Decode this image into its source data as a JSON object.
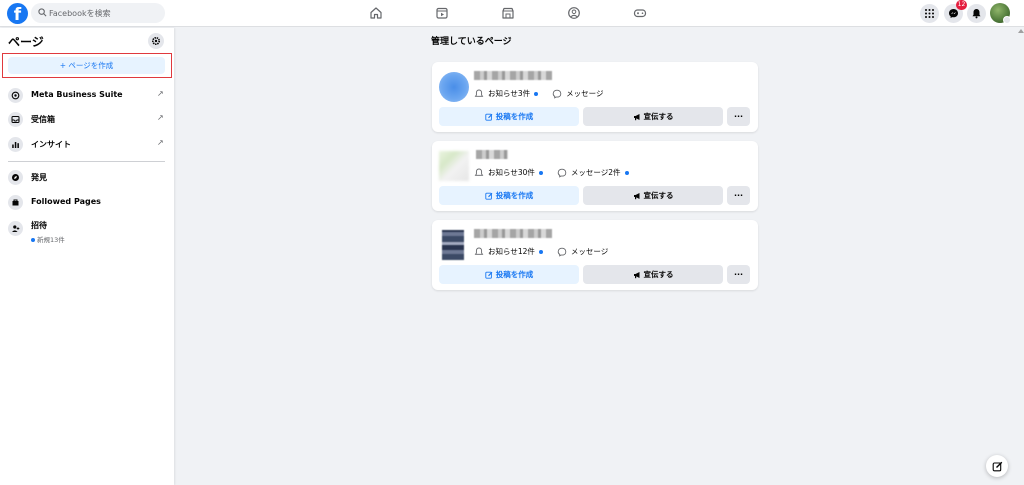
{
  "header": {
    "logo_letter": "f",
    "search_placeholder": "Facebookを検索",
    "nav_icons": [
      "home-icon",
      "video-icon",
      "marketplace-icon",
      "groups-icon",
      "gaming-icon"
    ],
    "messenger_badge": "12"
  },
  "sidebar": {
    "title": "ページ",
    "create_label": "+ ページを作成",
    "items": [
      {
        "label": "Meta Business Suite",
        "icon": "meta-business-icon",
        "external": "↗"
      },
      {
        "label": "受信箱",
        "icon": "inbox-icon",
        "external": "↗"
      },
      {
        "label": "インサイト",
        "icon": "insights-icon",
        "external": "↗"
      },
      {
        "label": "発見",
        "icon": "discover-icon"
      },
      {
        "label": "Followed Pages",
        "icon": "followed-pages-icon"
      },
      {
        "label": "招待",
        "icon": "invite-icon",
        "sub": "新規13件"
      }
    ]
  },
  "main": {
    "title": "管理しているページ",
    "pages": [
      {
        "notifications": "お知らせ3件",
        "notif_dot": true,
        "messages": "メッセージ",
        "msg_dot": false,
        "post_label": "投稿を作成",
        "promote_label": "宣伝する",
        "more_label": "···"
      },
      {
        "notifications": "お知らせ30件",
        "notif_dot": true,
        "messages": "メッセージ2件",
        "msg_dot": true,
        "post_label": "投稿を作成",
        "promote_label": "宣伝する",
        "more_label": "···"
      },
      {
        "notifications": "お知らせ12件",
        "notif_dot": true,
        "messages": "メッセージ",
        "msg_dot": false,
        "post_label": "投稿を作成",
        "promote_label": "宣伝する",
        "more_label": "···"
      }
    ]
  },
  "colors": {
    "brand": "#1877f2",
    "highlight_box": "#e0393e",
    "badge": "#e41e3f"
  }
}
